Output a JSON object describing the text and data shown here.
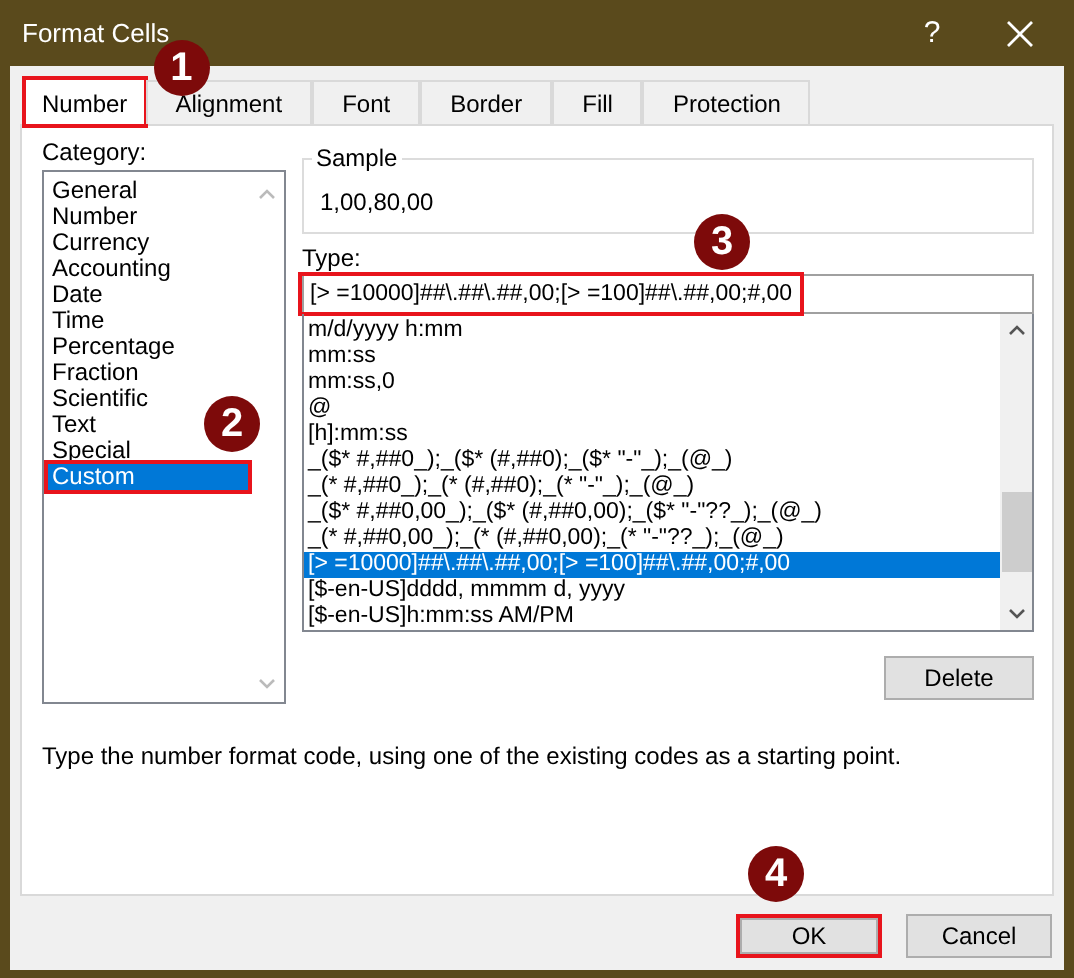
{
  "window": {
    "title": "Format Cells",
    "help": "?"
  },
  "tabs": [
    {
      "label": "Number",
      "selected": true,
      "highlighted": true,
      "callout": "1"
    },
    {
      "label": "Alignment",
      "selected": false,
      "highlighted": false
    },
    {
      "label": "Font",
      "selected": false,
      "highlighted": false
    },
    {
      "label": "Border",
      "selected": false,
      "highlighted": false
    },
    {
      "label": "Fill",
      "selected": false,
      "highlighted": false
    },
    {
      "label": "Protection",
      "selected": false,
      "highlighted": false
    }
  ],
  "category": {
    "label": "Category:",
    "callout": "2",
    "items": [
      {
        "label": "General",
        "selected": false,
        "highlighted": false
      },
      {
        "label": "Number",
        "selected": false,
        "highlighted": false
      },
      {
        "label": "Currency",
        "selected": false,
        "highlighted": false
      },
      {
        "label": "Accounting",
        "selected": false,
        "highlighted": false
      },
      {
        "label": "Date",
        "selected": false,
        "highlighted": false
      },
      {
        "label": "Time",
        "selected": false,
        "highlighted": false
      },
      {
        "label": "Percentage",
        "selected": false,
        "highlighted": false
      },
      {
        "label": "Fraction",
        "selected": false,
        "highlighted": false
      },
      {
        "label": "Scientific",
        "selected": false,
        "highlighted": false
      },
      {
        "label": "Text",
        "selected": false,
        "highlighted": false
      },
      {
        "label": "Special",
        "selected": false,
        "highlighted": false
      },
      {
        "label": "Custom",
        "selected": true,
        "highlighted": true
      }
    ]
  },
  "sample": {
    "label": "Sample",
    "value": "1,00,80,00"
  },
  "type": {
    "label": "Type:",
    "value": "[> =10000]##\\.##\\.##,00;[> =100]##\\.##,00;#,00",
    "highlighted": true,
    "callout": "3"
  },
  "formats": [
    {
      "code": "m/d/yyyy h:mm",
      "selected": false
    },
    {
      "code": "mm:ss",
      "selected": false
    },
    {
      "code": "mm:ss,0",
      "selected": false
    },
    {
      "code": "@",
      "selected": false
    },
    {
      "code": "[h]:mm:ss",
      "selected": false
    },
    {
      "code": "_($* #,##0_);_($* (#,##0);_($* \"-\"_);_(@_)",
      "selected": false
    },
    {
      "code": "_(* #,##0_);_(* (#,##0);_(* \"-\"_);_(@_)",
      "selected": false
    },
    {
      "code": "_($* #,##0,00_);_($* (#,##0,00);_($* \"-\"??_);_(@_)",
      "selected": false
    },
    {
      "code": "_(* #,##0,00_);_(* (#,##0,00);_(* \"-\"??_);_(@_)",
      "selected": false
    },
    {
      "code": "[> =10000]##\\.##\\.##,00;[> =100]##\\.##,00;#,00",
      "selected": true
    },
    {
      "code": "[$-en-US]dddd, mmmm d, yyyy",
      "selected": false
    },
    {
      "code": "[$-en-US]h:mm:ss AM/PM",
      "selected": false
    }
  ],
  "delete_button": "Delete",
  "description": "Type the number format code, using one of the existing codes as a starting point.",
  "buttons": [
    {
      "label": "OK",
      "highlighted": true,
      "callout": "4"
    },
    {
      "label": "Cancel",
      "highlighted": false
    }
  ]
}
